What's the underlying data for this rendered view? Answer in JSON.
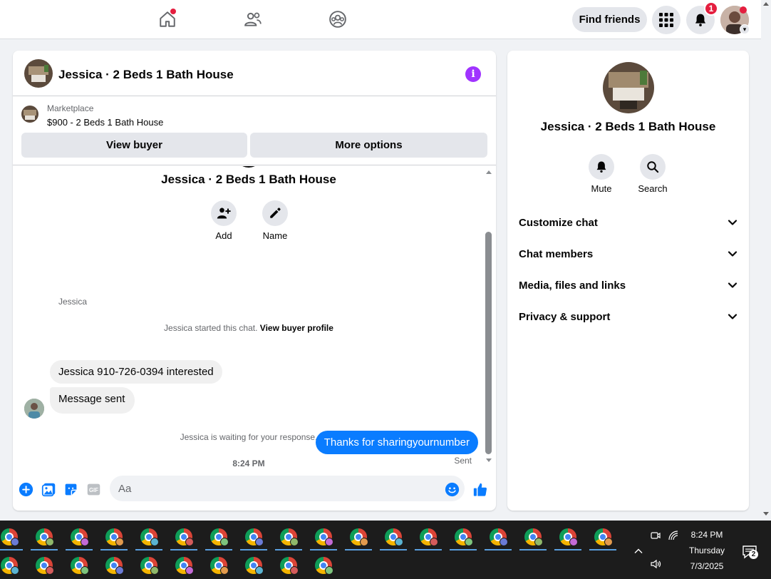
{
  "topbar": {
    "find_friends_label": "Find friends",
    "notification_count": "1"
  },
  "chat": {
    "title": "Jessica · 2 Beds 1 Bath House",
    "listing_source": "Marketplace",
    "listing_title": "$900 - 2 Beds 1 Bath House",
    "view_buyer_label": "View buyer",
    "more_options_label": "More options",
    "conversation_name": "Jessica · 2 Beds 1 Bath House",
    "add_label": "Add",
    "name_label": "Name",
    "started_text": "Jessica started this chat.",
    "view_buyer_profile_label": "View buyer profile",
    "sender_name": "Jessica",
    "messages_in": [
      "Jessica 910-726-0394 interested",
      "Message sent"
    ],
    "waiting_text": "Jessica is waiting for your response.",
    "timestamp": "8:24 PM",
    "message_out": "Thanks for sharingyournumber",
    "sent_status": "Sent",
    "composer_placeholder": "Aa"
  },
  "right_panel": {
    "title": "Jessica · 2 Beds 1 Bath House",
    "mute_label": "Mute",
    "search_label": "Search",
    "sections": [
      "Customize chat",
      "Chat members",
      "Media, files and links",
      "Privacy & support"
    ]
  },
  "taskbar": {
    "time": "8:24 PM",
    "day": "Thursday",
    "date": "7/3/2025",
    "notification_count": "2"
  },
  "colors": {
    "accent_blue": "#0a7cff",
    "info_purple": "#a033ff",
    "badge_red": "#e41e3f"
  }
}
